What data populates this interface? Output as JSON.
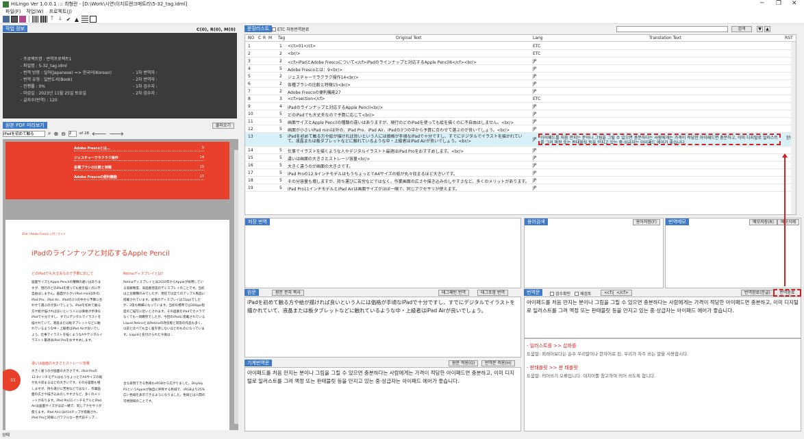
{
  "window": {
    "title": "HiLingo Ver 1.0.0.1 ::: 최형란 - [D:\\Work\\시연\\이지트렌크매트리\\5-32_tag.idml]",
    "minimize": "─",
    "maximize": "❐",
    "close": "✕"
  },
  "menu": [
    "파일(F)",
    "작업(W)",
    "프로젝트(J)"
  ],
  "toolbar": {
    "icons": [
      "floppy-icon",
      "dark-square-icon",
      "pink-square-icon",
      "barcode-icon",
      "barcode-icon",
      "arrow-up-icon",
      "arrow-down-icon",
      "check-icon",
      "warning-icon",
      "list-icon",
      "document-icon"
    ],
    "check": "✔",
    "warning": "▲",
    "up": "🡑",
    "down": "🡓"
  },
  "project": {
    "header": "작업 정보",
    "status_counts": "C(0), R(0), M(0)",
    "rows": [
      "- 프로젝트명 :   번역프로젝트1",
      "   - 파일명 :   5-32_tag.idml",
      "- 번역 방향 :   일어(Japanese) => 한국어(Korean)",
      "- 번역 유형 :   일반도서(Book)",
      "   - 진행률 :   0%",
      "   - 마감일 :   2023년 11월 25일 토요일",
      "- 글자수(번역) :   120"
    ],
    "right_rows": [
      "- 1차 번역자 :",
      "- 2차 번역자 :",
      "- 1차 검수자 :",
      "- 2차 검수자 :"
    ]
  },
  "pdf": {
    "header": "원본 PDF 미리보기",
    "close_label": "불러오기",
    "search_value": "iPadを初めて触る",
    "page_value": "2",
    "page_total": "of 28",
    "toc": [
      {
        "t": "Adobe Frescoとは…",
        "p": "9"
      },
      {
        "t": "ジェスチャーでラクラク操作",
        "p": "14"
      },
      {
        "t": "各種ブラシの比較と特徴",
        "p": "15"
      },
      {
        "t": "Adobe Frescoの便利機能",
        "p": "27"
      }
    ],
    "breadcrumb": "iPad / Adobe Fresco 入門 / ガイド",
    "page_title": "iPadのラインナップと対応するApple Pencil",
    "left_sub": "どのiPadでも大丈夫なので予算に応じて",
    "right_sub": "Retinaディスプレイとは？",
    "left_para": "画面サイズとApple Pencilの種類の違いはありますが、現行のどのiPadを使っても絵を描くのに不自由はしません。画面が小さいiPad miniは外の、iPad Pro、iPad Air、iPadの3つの中から予算に合わせて選ぶのが良いでしょう。iPadを初めて触る方や絵が描ければ良いという人には価格が手頃なiPadで十分ですし、すでにデジタルでイラストを描かれていて、液晶または板タブレットなどに触れているような中・上級者はiPad Airが良いでしょう。仕事でイラストを描くようなAやデジタルイラストト最適はiPad Proをおすすめします。",
    "left_sub2": "違いは画面の大きさとストレージ容量",
    "left_para2": "大きく違うのが画面の大きさです。iPad Proの12.9インチモデルはもうちょっとでA4サイズの紙が丸々収まるほどの大きいです。その分容量も増しますが、持ち運びに苦労などではなく、作業画面の広さや描き込みのしやすさなど、多くのメリットがあります。iPad Pro11インチモデルとiPad Airは画面サイズがほぼ一緒で、同じアクセサリが使えます。iPad AirにはA14チップが搭載され、iPad Proと同様にパワフルな一世代前チップ…",
    "right_para": "Retinaディスプレイとは2010年からAppleが採用している高解像度、高画素密度のディスプレイのことです。当初は上位機種のみでしたが、現在では全てのアップル製品に搭載されています。従来のディスプレイは72ppiでしたが、2倍も精細になっています。当初の標準では300ppi程度のご描写に近いとされます。その画素をiPadでカメラでなくても一目瞭然でしたが、今回のiPadに搭載されているLiquid RetinaとはRetinaの改良版と同等の作品も多く、以前と比べても全く差を感じないほどのものになっています。Liquidと名付けられた今後は…",
    "right_para2": "主な表現できる色域もsRGBから広がりました。Display P3というAppleが独自に呼称する色域で、sRGBより25%広い色域を表示できるようになりました。色域とは人間の可視領域のことです。",
    "page_badge": "01"
  },
  "segments": {
    "header": "문장리스트",
    "etc_checkbox": "ETC 자동번역완료",
    "search_button": "검색",
    "columns": [
      "NO",
      "C",
      "R",
      "M",
      "Tag",
      "Original Text",
      "Lang",
      "Translation Text",
      "RST"
    ],
    "rows": [
      {
        "no": "1",
        "tag": "1",
        "orig": "<ct>01</ct>",
        "lang": "ETC",
        "trans": ""
      },
      {
        "no": "2",
        "tag": "2",
        "orig": "<br/>",
        "lang": "ETC",
        "trans": ""
      },
      {
        "no": "3",
        "tag": "2",
        "orig": "<cf>iPadとAdobe Frescoについて</cf>iPadのラインナップと対応するApple Pencil6</cf><br/>",
        "lang": "JP",
        "trans": ""
      },
      {
        "no": "4",
        "tag": "5",
        "orig": "Adobe Frescoとは：9<br/>",
        "lang": "JP",
        "trans": ""
      },
      {
        "no": "5",
        "tag": "2",
        "orig": "ジェスチャーでラクラク操作14<br/>",
        "lang": "JP",
        "trans": ""
      },
      {
        "no": "6",
        "tag": "2",
        "orig": "各種ブラシの比較と特徴15<br/>",
        "lang": "JP",
        "trans": ""
      },
      {
        "no": "7",
        "tag": "2",
        "orig": "Adobe Frescoの便利機能27",
        "lang": "JP",
        "trans": ""
      },
      {
        "no": "8",
        "tag": "3",
        "orig": "<cf>section</cf>",
        "lang": "ETC",
        "trans": ""
      },
      {
        "no": "9",
        "tag": "4",
        "orig": "iPadのラインナップと対応するApple Pencil<br/>",
        "lang": "JP",
        "trans": ""
      },
      {
        "no": "10",
        "tag": "5",
        "orig": "どのiPadでも大丈夫なので予算に応じて<br/>",
        "lang": "JP",
        "trans": ""
      },
      {
        "no": "11",
        "tag": "5",
        "orig": "画面サイズとApple Pencilの種類の違いはありますが、現行のどのiPadを使っても絵を描くのに不自由はしません。<br/>",
        "lang": "JP",
        "trans": ""
      },
      {
        "no": "12",
        "tag": "5",
        "orig": "画面が小さいiPad miniは外の、iPad Pro、iPad Air、iPadの3つの中から予算に合わせて選ぶのが良いでしょう。<br/>",
        "lang": "JP",
        "trans": ""
      },
      {
        "no": "13",
        "tag": "5",
        "orig": "iPadを初めて触る方や絵が描ければ良いという人には価格が手頃なiPadで十分ですし、すでにデジタルでイラストを描かれていて、液晶または板タブレットなどに触れているような中・上級者はiPad Airが良いでしょう。<br/>",
        "lang": "JP",
        "trans": "아이패드를 처음 만지는 분이나 그림을 그릴 수 있으면 충분하다는 사람에게는 가격이 적당한 아이패드면 충분하고, 이미 디지털로 일러스트를 그려 액정 또는 판태블릿 등을 만지고 있는 중·상급자는 아이패드 에어가 좋습니다.",
        "rst": "완료"
      },
      {
        "no": "14",
        "tag": "5",
        "orig": "仕事でイラストを描くような人やデジタルイラストト最適はiPad Proをおすすめします。<br/>",
        "lang": "JP",
        "trans": ""
      },
      {
        "no": "15",
        "tag": "5",
        "orig": "違いは画面の大きさとストレージ容量<br/>",
        "lang": "JP",
        "trans": ""
      },
      {
        "no": "16",
        "tag": "5",
        "orig": "大きく違うのが画面の大きさです。",
        "lang": "JP",
        "trans": ""
      },
      {
        "no": "17",
        "tag": "5",
        "orig": "iPad Proの12.9インチモデルはもうちょっとでA4サイズの紙が丸々収まるほど大きいです。",
        "lang": "JP",
        "trans": ""
      },
      {
        "no": "18",
        "tag": "5",
        "orig": "その分容量も増しますが、持ち運びに苦労などではなく、作業画面の広さや描き込みのしやすさなど、多くのメリットがあります。",
        "lang": "JP",
        "trans": ""
      },
      {
        "no": "19",
        "tag": "5",
        "orig": "iPad Pro11インチモデルとiPad Airは画面サイズがほぼ一緒で、同じアクセサリが使えます。",
        "lang": "JP",
        "trans": ""
      }
    ]
  },
  "save": {
    "header": "저장 번역"
  },
  "terms": {
    "header": "용어검색",
    "button": "용어저장(F)"
  },
  "memo": {
    "header": "번역메모",
    "save": "메모저장(R)",
    "delete": "메모삭제"
  },
  "source": {
    "header": "원문",
    "copy_btn": "원문 문자 복사",
    "tag_btn": "태그패턴 번역",
    "tag_copy_btn": "태그포함 번역",
    "text": "iPadを初めて触る方や絵が描ければ良いという人には価格が手頃なiPadで十分ですし、すでにデジタルでイラストを描かれていて、液晶または板タブレットなどに触れているような中・上級者はiPad Airが良いでしょう。"
  },
  "mt": {
    "header": "기계번역문",
    "apply_all": "원문 적용(G)",
    "apply": "번역문 적용(H)",
    "text": "아이패드를 처음 만지는 분이나 그림을 그릴 수 있으면 충분하다는 사람에게는 가격이 적당한 아이패드면 충분하고, 이미 디지털로 일러스트를 그려 액정 또는 판태블릿 등을 만지고 있는 중·상급자는 아이패드 에어가 좋습니다."
  },
  "translation": {
    "header": "번역문",
    "review": "검수확인",
    "reject": "재검토",
    "tag_a": "<cf>",
    "tag_b": "</cf>",
    "complete_btn": "번역완료(한글)",
    "complete_btn2": "번역완료(en)",
    "text": "아이패드를 처음 만지는 분이나 그림을 그릴 수 있으면 충분하다는 사람에게는 가격이 적당한 아이패드면 충분하고, 이미 디지털로 일러스트를 그려 액정 또는 판태블릿 등을 만지고 있는 중·상급자는 아이패드 에어가 좋습니다."
  },
  "notes": [
    {
      "title": "- 일러스트를  >>  삽화를",
      "body": "도움말: 외래어보다는 순수 우리말이나 한자어로 된, 우리가 자주 쓰는 말을 사용합시다."
    },
    {
      "title": "- 판태블릿  >>  판 태블릿",
      "body": "도움말: 띄어쓰기 오류입니다. 대치어를 참고하여 띄어 쓰도록 합니다."
    }
  ],
  "status": "상태",
  "colors": {
    "accent": "#3e7ac8",
    "highlight": "#d12020",
    "pdf_red": "#e8402a"
  }
}
